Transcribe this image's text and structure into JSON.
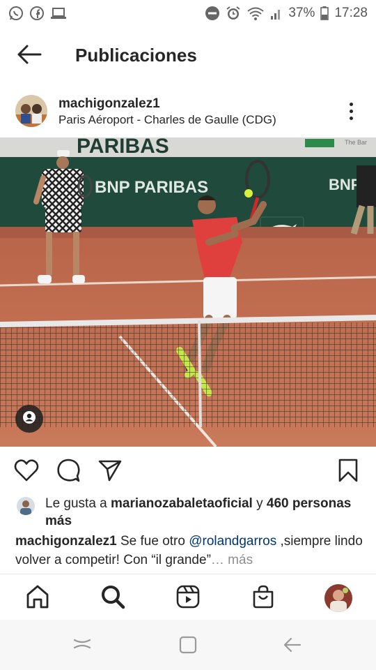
{
  "status_bar": {
    "left_icons": [
      "whatsapp-icon",
      "facebook-icon",
      "laptop-icon"
    ],
    "right_icons": [
      "do-not-disturb-icon",
      "alarm-icon",
      "wifi-icon",
      "signal-icon",
      "battery-icon"
    ],
    "battery": "37%",
    "time": "17:28"
  },
  "header": {
    "title": "Publicaciones"
  },
  "post": {
    "username": "machigonzalez1",
    "location": "Paris Aéroport - Charles de Gaulle (CDG)",
    "image_texts": {
      "banner_top": "PARIBAS",
      "banner_top_right": "The Bar",
      "banner_main": "BNP PARIBAS",
      "banner_right": "BNP"
    },
    "likes": {
      "prefix": "Le gusta a ",
      "liker": "marianozabaletaoficial",
      "middle": " y ",
      "others": "460 personas más"
    },
    "caption": {
      "username": "machigonzalez1",
      "text_before": " Se fue otro ",
      "mention": "@rolandgarros",
      "text_after": " ,siempre lindo volver a competir! Con “il grande”",
      "more": "… más"
    }
  },
  "icons": {
    "back": "arrow-left-icon",
    "more": "more-vertical-icon",
    "user_tag": "user-tag-icon",
    "actions": [
      "heart-icon",
      "comment-icon",
      "share-icon",
      "bookmark-icon"
    ],
    "bottom_nav": [
      "home-icon",
      "search-icon",
      "reels-icon",
      "shop-icon",
      "profile-avatar"
    ],
    "system_nav": [
      "recents-icon",
      "home-square-icon",
      "system-back-icon"
    ]
  },
  "colors": {
    "text": "#262626",
    "mention": "#00376b",
    "muted": "#8e8e8e",
    "clay": "#c4694a",
    "player_shirt": "#e0403d",
    "wall_green": "#1f4a3c"
  }
}
